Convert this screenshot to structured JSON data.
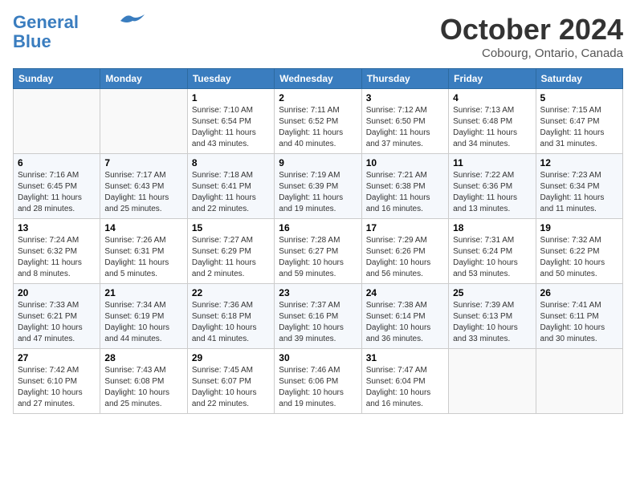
{
  "header": {
    "logo_line1": "General",
    "logo_line2": "Blue",
    "month_title": "October 2024",
    "subtitle": "Cobourg, Ontario, Canada"
  },
  "days_of_week": [
    "Sunday",
    "Monday",
    "Tuesday",
    "Wednesday",
    "Thursday",
    "Friday",
    "Saturday"
  ],
  "weeks": [
    [
      {
        "day": "",
        "info": ""
      },
      {
        "day": "",
        "info": ""
      },
      {
        "day": "1",
        "info": "Sunrise: 7:10 AM\nSunset: 6:54 PM\nDaylight: 11 hours and 43 minutes."
      },
      {
        "day": "2",
        "info": "Sunrise: 7:11 AM\nSunset: 6:52 PM\nDaylight: 11 hours and 40 minutes."
      },
      {
        "day": "3",
        "info": "Sunrise: 7:12 AM\nSunset: 6:50 PM\nDaylight: 11 hours and 37 minutes."
      },
      {
        "day": "4",
        "info": "Sunrise: 7:13 AM\nSunset: 6:48 PM\nDaylight: 11 hours and 34 minutes."
      },
      {
        "day": "5",
        "info": "Sunrise: 7:15 AM\nSunset: 6:47 PM\nDaylight: 11 hours and 31 minutes."
      }
    ],
    [
      {
        "day": "6",
        "info": "Sunrise: 7:16 AM\nSunset: 6:45 PM\nDaylight: 11 hours and 28 minutes."
      },
      {
        "day": "7",
        "info": "Sunrise: 7:17 AM\nSunset: 6:43 PM\nDaylight: 11 hours and 25 minutes."
      },
      {
        "day": "8",
        "info": "Sunrise: 7:18 AM\nSunset: 6:41 PM\nDaylight: 11 hours and 22 minutes."
      },
      {
        "day": "9",
        "info": "Sunrise: 7:19 AM\nSunset: 6:39 PM\nDaylight: 11 hours and 19 minutes."
      },
      {
        "day": "10",
        "info": "Sunrise: 7:21 AM\nSunset: 6:38 PM\nDaylight: 11 hours and 16 minutes."
      },
      {
        "day": "11",
        "info": "Sunrise: 7:22 AM\nSunset: 6:36 PM\nDaylight: 11 hours and 13 minutes."
      },
      {
        "day": "12",
        "info": "Sunrise: 7:23 AM\nSunset: 6:34 PM\nDaylight: 11 hours and 11 minutes."
      }
    ],
    [
      {
        "day": "13",
        "info": "Sunrise: 7:24 AM\nSunset: 6:32 PM\nDaylight: 11 hours and 8 minutes."
      },
      {
        "day": "14",
        "info": "Sunrise: 7:26 AM\nSunset: 6:31 PM\nDaylight: 11 hours and 5 minutes."
      },
      {
        "day": "15",
        "info": "Sunrise: 7:27 AM\nSunset: 6:29 PM\nDaylight: 11 hours and 2 minutes."
      },
      {
        "day": "16",
        "info": "Sunrise: 7:28 AM\nSunset: 6:27 PM\nDaylight: 10 hours and 59 minutes."
      },
      {
        "day": "17",
        "info": "Sunrise: 7:29 AM\nSunset: 6:26 PM\nDaylight: 10 hours and 56 minutes."
      },
      {
        "day": "18",
        "info": "Sunrise: 7:31 AM\nSunset: 6:24 PM\nDaylight: 10 hours and 53 minutes."
      },
      {
        "day": "19",
        "info": "Sunrise: 7:32 AM\nSunset: 6:22 PM\nDaylight: 10 hours and 50 minutes."
      }
    ],
    [
      {
        "day": "20",
        "info": "Sunrise: 7:33 AM\nSunset: 6:21 PM\nDaylight: 10 hours and 47 minutes."
      },
      {
        "day": "21",
        "info": "Sunrise: 7:34 AM\nSunset: 6:19 PM\nDaylight: 10 hours and 44 minutes."
      },
      {
        "day": "22",
        "info": "Sunrise: 7:36 AM\nSunset: 6:18 PM\nDaylight: 10 hours and 41 minutes."
      },
      {
        "day": "23",
        "info": "Sunrise: 7:37 AM\nSunset: 6:16 PM\nDaylight: 10 hours and 39 minutes."
      },
      {
        "day": "24",
        "info": "Sunrise: 7:38 AM\nSunset: 6:14 PM\nDaylight: 10 hours and 36 minutes."
      },
      {
        "day": "25",
        "info": "Sunrise: 7:39 AM\nSunset: 6:13 PM\nDaylight: 10 hours and 33 minutes."
      },
      {
        "day": "26",
        "info": "Sunrise: 7:41 AM\nSunset: 6:11 PM\nDaylight: 10 hours and 30 minutes."
      }
    ],
    [
      {
        "day": "27",
        "info": "Sunrise: 7:42 AM\nSunset: 6:10 PM\nDaylight: 10 hours and 27 minutes."
      },
      {
        "day": "28",
        "info": "Sunrise: 7:43 AM\nSunset: 6:08 PM\nDaylight: 10 hours and 25 minutes."
      },
      {
        "day": "29",
        "info": "Sunrise: 7:45 AM\nSunset: 6:07 PM\nDaylight: 10 hours and 22 minutes."
      },
      {
        "day": "30",
        "info": "Sunrise: 7:46 AM\nSunset: 6:06 PM\nDaylight: 10 hours and 19 minutes."
      },
      {
        "day": "31",
        "info": "Sunrise: 7:47 AM\nSunset: 6:04 PM\nDaylight: 10 hours and 16 minutes."
      },
      {
        "day": "",
        "info": ""
      },
      {
        "day": "",
        "info": ""
      }
    ]
  ]
}
